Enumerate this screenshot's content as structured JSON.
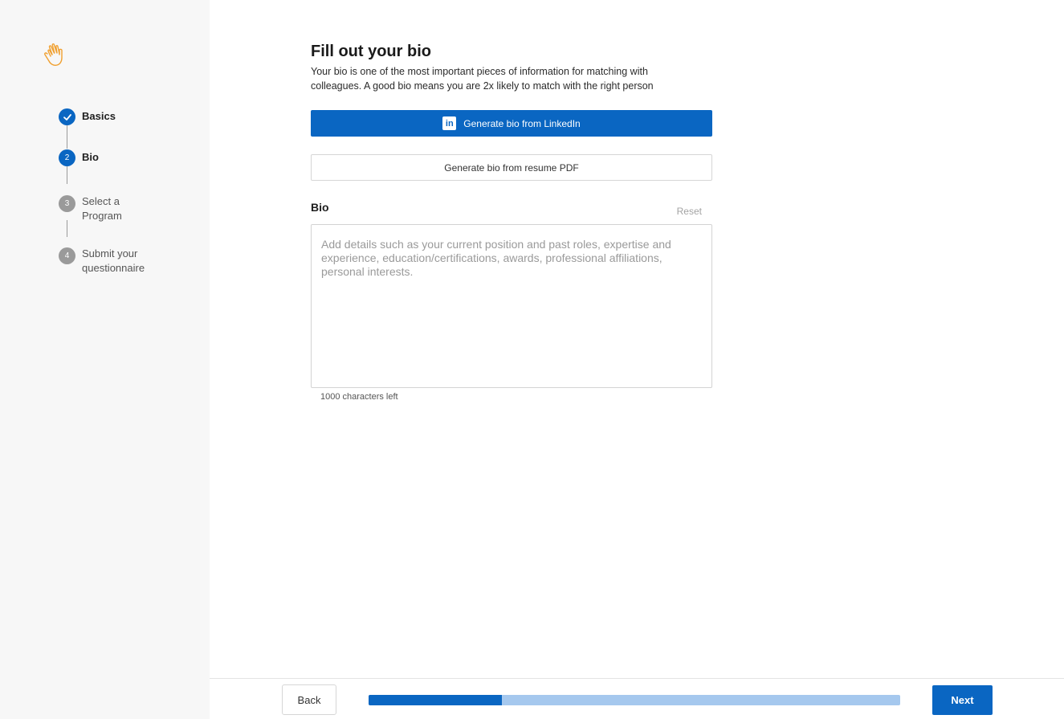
{
  "sidebar": {
    "logo_icon": "waving-hand-icon",
    "steps": [
      {
        "number": "1",
        "label": "Basics",
        "state": "done"
      },
      {
        "number": "2",
        "label": "Bio",
        "state": "active"
      },
      {
        "number": "3",
        "label": "Select a Program",
        "state": "todo"
      },
      {
        "number": "4",
        "label": "Submit your questionnaire",
        "state": "todo"
      }
    ]
  },
  "main": {
    "title": "Fill out your bio",
    "subtitle": "Your bio is one of the most important pieces of information for matching with colleagues. A good bio means you are 2x likely to match with the right person",
    "linkedin_button": "Generate bio from LinkedIn",
    "linkedin_icon_glyph": "in",
    "resume_button": "Generate bio from resume PDF",
    "bio_label": "Bio",
    "reset_label": "Reset",
    "bio_value": "",
    "bio_placeholder": "Add details such as your current position and past roles, expertise and experience, education/certifications, awards, professional affiliations, personal interests.",
    "chars_left": "1000 characters left"
  },
  "footer": {
    "back_label": "Back",
    "next_label": "Next",
    "progress": 0.25
  },
  "colors": {
    "accent": "#0a66c2",
    "progress_track": "#a5c8ee",
    "sidebar_bg": "#f7f7f7",
    "logo": "#f0a030"
  }
}
